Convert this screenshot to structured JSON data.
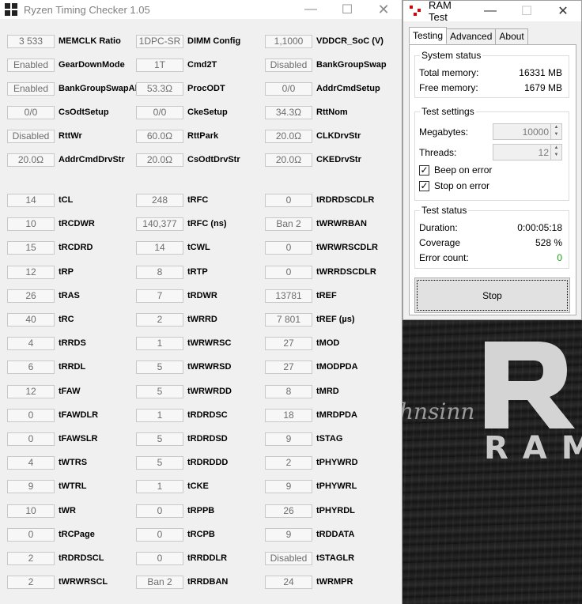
{
  "rtc": {
    "title": "Ryzen Timing Checker 1.05",
    "top_rows": [
      [
        {
          "v": "3 533",
          "l": "MEMCLK Ratio"
        },
        {
          "v": "1DPC-SR",
          "l": "DIMM Config"
        },
        {
          "v": "1,1000",
          "l": "VDDCR_SoC (V)"
        }
      ],
      [
        {
          "v": "Enabled",
          "l": "GearDownMode"
        },
        {
          "v": "1T",
          "l": "Cmd2T"
        },
        {
          "v": "Disabled",
          "l": "BankGroupSwap"
        }
      ],
      [
        {
          "v": "Enabled",
          "l": "BankGroupSwapAlt"
        },
        {
          "v": "53.3Ω",
          "l": "ProcODT"
        },
        {
          "v": "0/0",
          "l": "AddrCmdSetup"
        }
      ],
      [
        {
          "v": "0/0",
          "l": "CsOdtSetup"
        },
        {
          "v": "0/0",
          "l": "CkeSetup"
        },
        {
          "v": "34.3Ω",
          "l": "RttNom"
        }
      ],
      [
        {
          "v": "Disabled",
          "l": "RttWr"
        },
        {
          "v": "60.0Ω",
          "l": "RttPark"
        },
        {
          "v": "20.0Ω",
          "l": "CLKDrvStr"
        }
      ],
      [
        {
          "v": "20.0Ω",
          "l": "AddrCmdDrvStr"
        },
        {
          "v": "20.0Ω",
          "l": "CsOdtDrvStr"
        },
        {
          "v": "20.0Ω",
          "l": "CKEDrvStr"
        }
      ]
    ],
    "timing_rows": [
      [
        {
          "v": "14",
          "l": "tCL"
        },
        {
          "v": "248",
          "l": "tRFC"
        },
        {
          "v": "0",
          "l": "tRDRDSCDLR"
        }
      ],
      [
        {
          "v": "10",
          "l": "tRCDWR"
        },
        {
          "v": "140,377",
          "l": "tRFC (ns)"
        },
        {
          "v": "Ban 2",
          "l": "tWRWRBAN"
        }
      ],
      [
        {
          "v": "15",
          "l": "tRCDRD"
        },
        {
          "v": "14",
          "l": "tCWL"
        },
        {
          "v": "0",
          "l": "tWRWRSCDLR"
        }
      ],
      [
        {
          "v": "12",
          "l": "tRP"
        },
        {
          "v": "8",
          "l": "tRTP"
        },
        {
          "v": "0",
          "l": "tWRRDSCDLR"
        }
      ],
      [
        {
          "v": "26",
          "l": "tRAS"
        },
        {
          "v": "7",
          "l": "tRDWR"
        },
        {
          "v": "13781",
          "l": "tREF"
        }
      ],
      [
        {
          "v": "40",
          "l": "tRC"
        },
        {
          "v": "2",
          "l": "tWRRD"
        },
        {
          "v": "7 801",
          "l": "tREF (µs)"
        }
      ],
      [
        {
          "v": "4",
          "l": "tRRDS"
        },
        {
          "v": "1",
          "l": "tWRWRSC"
        },
        {
          "v": "27",
          "l": "tMOD"
        }
      ],
      [
        {
          "v": "6",
          "l": "tRRDL"
        },
        {
          "v": "5",
          "l": "tWRWRSD"
        },
        {
          "v": "27",
          "l": "tMODPDA"
        }
      ],
      [
        {
          "v": "12",
          "l": "tFAW"
        },
        {
          "v": "5",
          "l": "tWRWRDD"
        },
        {
          "v": "8",
          "l": "tMRD"
        }
      ],
      [
        {
          "v": "0",
          "l": "tFAWDLR"
        },
        {
          "v": "1",
          "l": "tRDRDSC"
        },
        {
          "v": "18",
          "l": "tMRDPDA"
        }
      ],
      [
        {
          "v": "0",
          "l": "tFAWSLR"
        },
        {
          "v": "5",
          "l": "tRDRDSD"
        },
        {
          "v": "9",
          "l": "tSTAG"
        }
      ],
      [
        {
          "v": "4",
          "l": "tWTRS"
        },
        {
          "v": "5",
          "l": "tRDRDDD"
        },
        {
          "v": "2",
          "l": "tPHYWRD"
        }
      ],
      [
        {
          "v": "9",
          "l": "tWTRL"
        },
        {
          "v": "1",
          "l": "tCKE"
        },
        {
          "v": "9",
          "l": "tPHYWRL"
        }
      ],
      [
        {
          "v": "10",
          "l": "tWR"
        },
        {
          "v": "0",
          "l": "tRPPB"
        },
        {
          "v": "26",
          "l": "tPHYRDL"
        }
      ],
      [
        {
          "v": "0",
          "l": "tRCPage"
        },
        {
          "v": "0",
          "l": "tRCPB"
        },
        {
          "v": "9",
          "l": "tRDDATA"
        }
      ],
      [
        {
          "v": "2",
          "l": "tRDRDSCL"
        },
        {
          "v": "0",
          "l": "tRRDDLR"
        },
        {
          "v": "Disabled",
          "l": "tSTAGLR"
        }
      ],
      [
        {
          "v": "2",
          "l": "tWRWRSCL"
        },
        {
          "v": "Ban 2",
          "l": "tRRDBAN"
        },
        {
          "v": "24",
          "l": "tWRMPR"
        }
      ]
    ]
  },
  "ramtest": {
    "title": "RAM Test",
    "tabs": [
      "Testing",
      "Advanced",
      "About"
    ],
    "system_status": {
      "title": "System status",
      "total_label": "Total memory:",
      "total_value": "16331 MB",
      "free_label": "Free memory:",
      "free_value": "1679 MB"
    },
    "test_settings": {
      "title": "Test settings",
      "megabytes_label": "Megabytes:",
      "megabytes_value": "10000",
      "threads_label": "Threads:",
      "threads_value": "12",
      "beep_label": "Beep on error",
      "beep_checked": true,
      "stop_label": "Stop on error",
      "stop_checked": true
    },
    "test_status": {
      "title": "Test status",
      "duration_label": "Duration:",
      "duration_value": "0:00:05:18",
      "coverage_label": "Coverage",
      "coverage_value": "528 %",
      "errors_label": "Error count:",
      "errors_value": "0",
      "errors_color": "#18a018"
    },
    "stop_button": "Stop"
  },
  "wallpaper": {
    "script_text": "hnsinn",
    "brand_text": "RAM"
  }
}
